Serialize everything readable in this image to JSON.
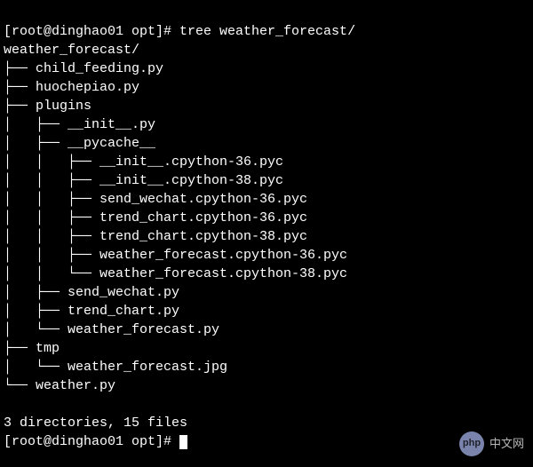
{
  "prompt": {
    "line1": "[root@dinghao01 opt]# tree weather_forecast/",
    "line2_partial": "[root@dinghao01 opt]#"
  },
  "tree": {
    "root": "weather_forecast/",
    "lines": [
      "├── child_feeding.py",
      "├── huochepiao.py",
      "├── plugins",
      "│   ├── __init__.py",
      "│   ├── __pycache__",
      "│   │   ├── __init__.cpython-36.pyc",
      "│   │   ├── __init__.cpython-38.pyc",
      "│   │   ├── send_wechat.cpython-36.pyc",
      "│   │   ├── trend_chart.cpython-36.pyc",
      "│   │   ├── trend_chart.cpython-38.pyc",
      "│   │   ├── weather_forecast.cpython-36.pyc",
      "│   │   └── weather_forecast.cpython-38.pyc",
      "│   ├── send_wechat.py",
      "│   ├── trend_chart.py",
      "│   └── weather_forecast.py",
      "├── tmp",
      "│   └── weather_forecast.jpg",
      "└── weather.py"
    ],
    "summary": "3 directories, 15 files"
  },
  "watermark": {
    "logo_text": "php",
    "label": "中文网"
  }
}
